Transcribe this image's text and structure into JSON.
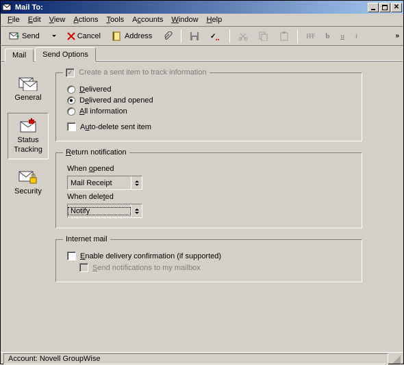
{
  "window": {
    "title": "Mail To:"
  },
  "menu": {
    "file": "File",
    "edit": "Edit",
    "view": "View",
    "actions": "Actions",
    "tools": "Tools",
    "accounts": "Accounts",
    "window": "Window",
    "help": "Help"
  },
  "toolbar": {
    "send": "Send",
    "cancel": "Cancel",
    "address": "Address",
    "fff": "FFF",
    "bold": "b",
    "underline": "u",
    "italic": "i"
  },
  "tabs": {
    "mail": "Mail",
    "send_options": "Send Options"
  },
  "sidebar": {
    "general": "General",
    "status_tracking": "Status Tracking",
    "security": "Security"
  },
  "panel": {
    "create_sent_item": {
      "legend": "Create a sent item to track information",
      "delivered": "Delivered",
      "delivered_and_opened": "Delivered and opened",
      "all_information": "All information",
      "auto_delete": "Auto-delete sent item",
      "selected": "delivered_and_opened",
      "auto_delete_checked": false
    },
    "return_notification": {
      "legend": "Return notification",
      "when_opened_label": "When opened",
      "when_opened_value": "Mail Receipt",
      "when_deleted_label": "When deleted",
      "when_deleted_value": "Notify"
    },
    "internet_mail": {
      "legend": "Internet mail",
      "enable_delivery": "Enable delivery confirmation (if supported)",
      "send_notifications": "Send notifications to my mailbox",
      "enable_delivery_checked": false
    }
  },
  "statusbar": {
    "account": "Account: Novell GroupWise"
  }
}
